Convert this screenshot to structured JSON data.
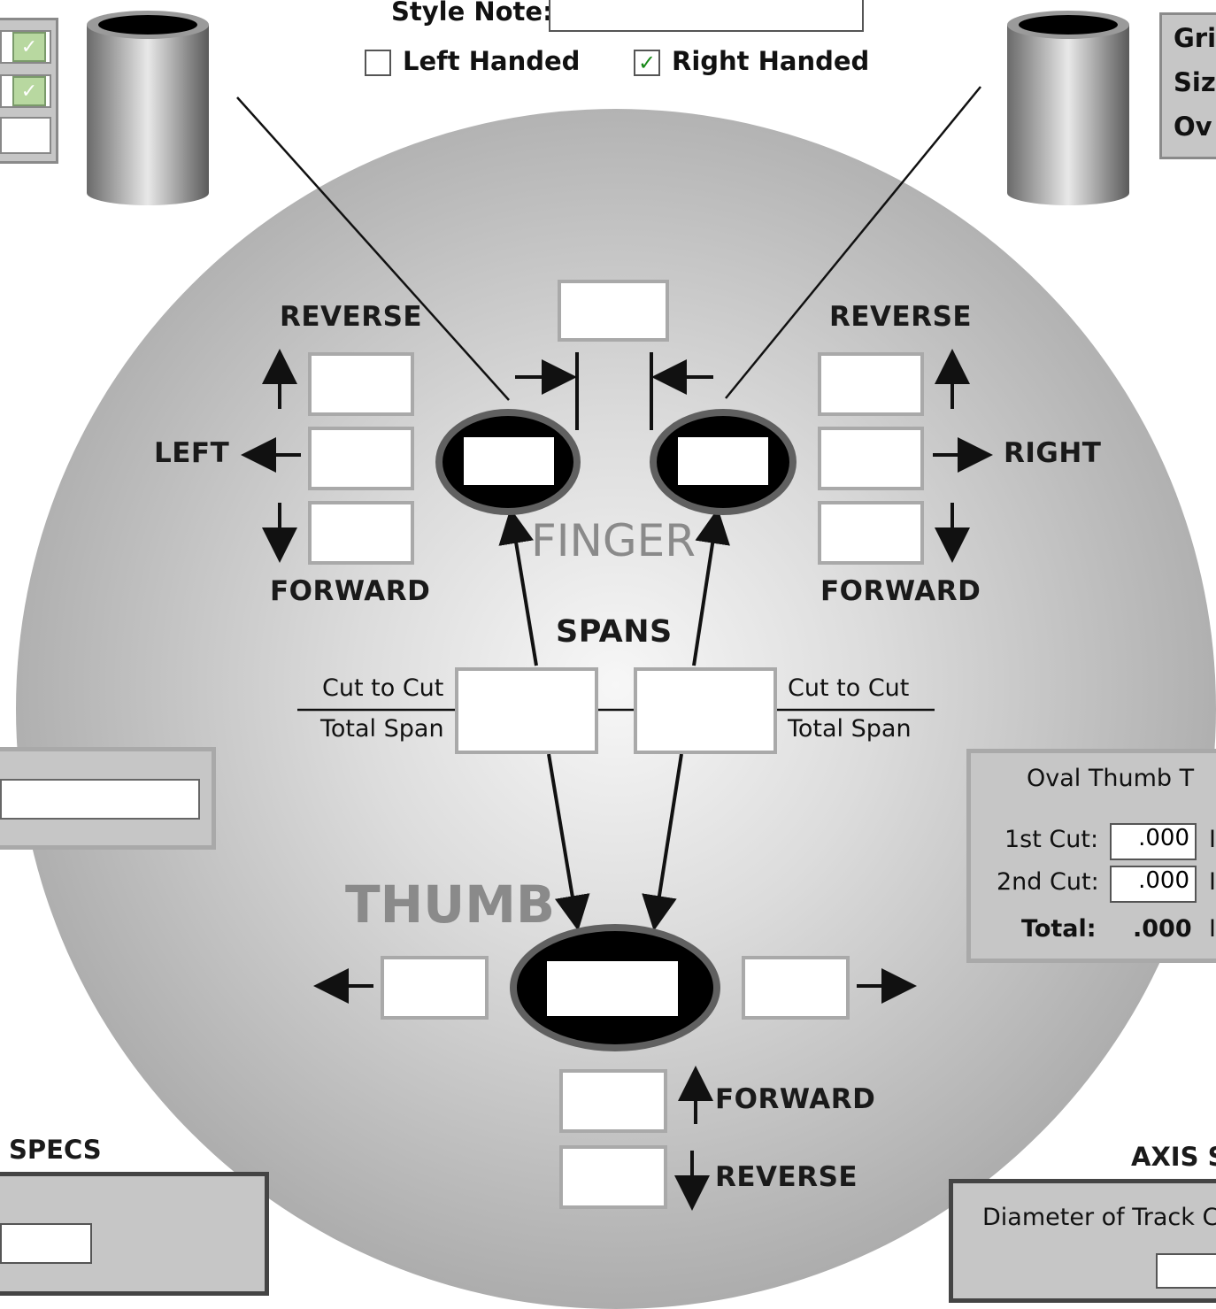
{
  "header": {
    "style_note_label": "Style Note:",
    "left_handed_label": "Left Handed",
    "left_handed_checked": false,
    "right_handed_label": "Right Handed",
    "right_handed_checked": true
  },
  "right_panel_partial": {
    "line1": "Gri",
    "line2": "Siz",
    "line3": "Ov"
  },
  "ball": {
    "left_reverse_label": "REVERSE",
    "left_forward_label": "FORWARD",
    "left_label": "LEFT",
    "right_reverse_label": "REVERSE",
    "right_forward_label": "FORWARD",
    "right_label": "RIGHT",
    "finger_label": "FINGER",
    "spans_label": "SPANS",
    "thumb_label": "THUMB",
    "left_cut_to_cut": "Cut to Cut",
    "left_total_span": "Total Span",
    "right_cut_to_cut": "Cut to Cut",
    "right_total_span": "Total Span",
    "thumb_forward_label": "FORWARD",
    "thumb_reverse_label": "REVERSE"
  },
  "oval_thumb": {
    "title": "Oval Thumb T",
    "first_cut_label": "1st Cut:",
    "first_cut_value": ".000",
    "second_cut_label": "2nd Cut:",
    "second_cut_value": ".000",
    "total_label": "Total:",
    "total_value": ".000",
    "unit_partial_1": "I",
    "unit_partial_2": "I",
    "unit_partial_3": "I"
  },
  "specs_label": "SPECS",
  "axis": {
    "title": "AXIS S",
    "diameter_label": "Diameter of Track Ci"
  },
  "colors": {
    "checkbox_check": "#1a8a1a",
    "dropdown_button": "#b8d8a0",
    "panel_bg": "#c6c6c6"
  }
}
